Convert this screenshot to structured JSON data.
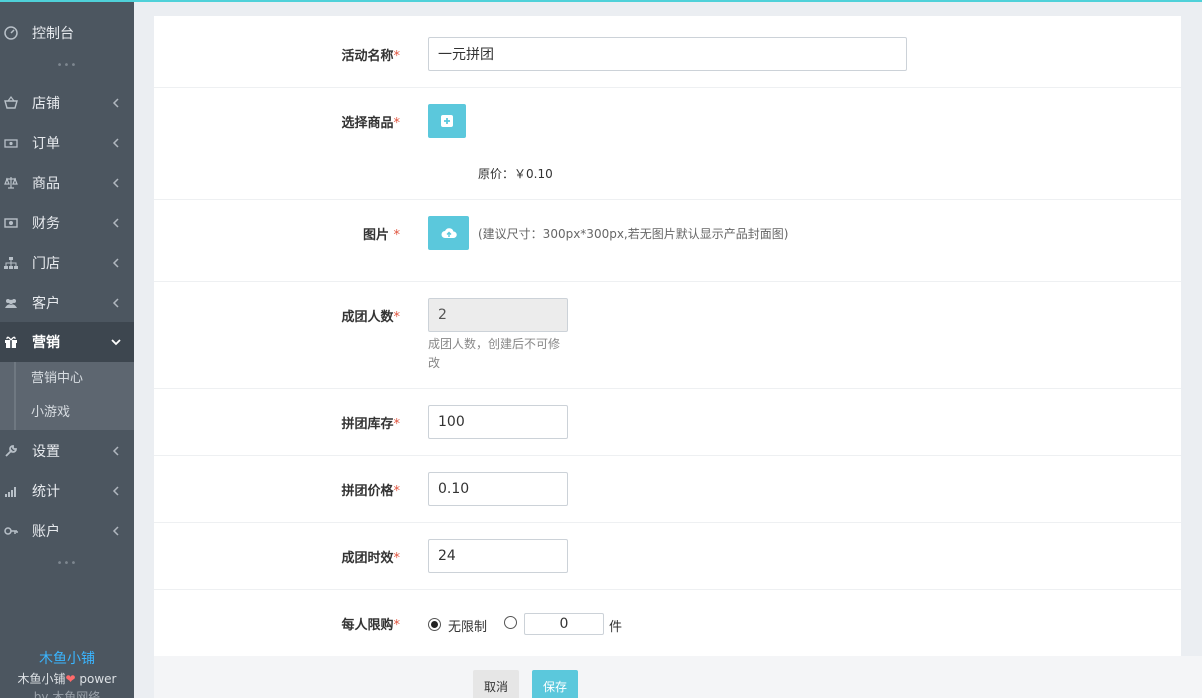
{
  "sidebar": {
    "items": [
      {
        "label": "控制台",
        "icon": "dashboard-icon"
      },
      {
        "label": "店铺",
        "icon": "basket-icon"
      },
      {
        "label": "订单",
        "icon": "money-icon"
      },
      {
        "label": "商品",
        "icon": "scale-icon"
      },
      {
        "label": "财务",
        "icon": "cash-icon"
      },
      {
        "label": "门店",
        "icon": "sitemap-icon"
      },
      {
        "label": "客户",
        "icon": "users-icon"
      },
      {
        "label": "营销",
        "icon": "gift-icon"
      },
      {
        "label": "设置",
        "icon": "wrench-icon"
      },
      {
        "label": "统计",
        "icon": "signal-icon"
      },
      {
        "label": "账户",
        "icon": "key-icon"
      }
    ],
    "submenu": [
      "营销中心",
      "小游戏"
    ],
    "brand": "木鱼小铺",
    "powered_prefix": "木鱼小铺",
    "powered_suffix": " power",
    "powered_by": "by 木鱼网络"
  },
  "form": {
    "activity_name": {
      "label": "活动名称",
      "value": "一元拼团"
    },
    "select_product": {
      "label": "选择商品",
      "original_price": "原价：￥0.10"
    },
    "image": {
      "label": "图片 ",
      "hint": "(建议尺寸：300px*300px,若无图片默认显示产品封面图)"
    },
    "group_size": {
      "label": "成团人数",
      "value": "2",
      "hint": "成团人数，创建后不可修改"
    },
    "group_stock": {
      "label": "拼团库存",
      "value": "100"
    },
    "group_price": {
      "label": "拼团价格",
      "value": "0.10"
    },
    "group_time": {
      "label": "成团时效",
      "value": "24"
    },
    "limit": {
      "label": "每人限购",
      "option_unlimited": "无限制",
      "value": "0",
      "unit": "件"
    },
    "required_mark": "*"
  },
  "footer": {
    "cancel": "取消",
    "save": "保存"
  },
  "colors": {
    "accent": "#5bc8dc",
    "sidebar_bg": "#4c5660",
    "brand": "#3ab5ff",
    "required": "#e0533d"
  }
}
